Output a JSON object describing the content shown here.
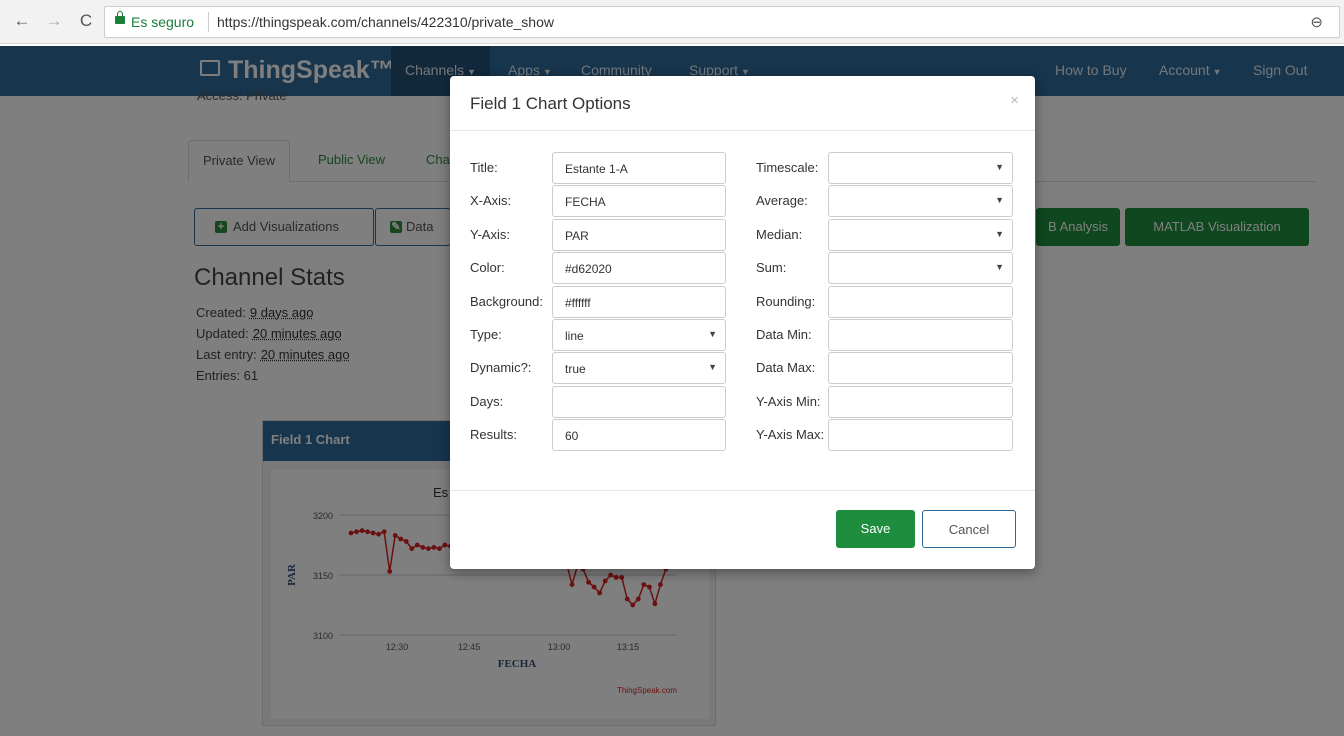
{
  "browser": {
    "secure_label": "Es seguro",
    "url": "https://thingspeak.com/channels/422310/private_show",
    "back_icon": "←",
    "forward_icon": "→",
    "reload_icon": "C",
    "zoom_icon": "⊖"
  },
  "nav": {
    "logo": "ThingSpeak™",
    "items": [
      "Channels",
      "Apps",
      "Community",
      "Support"
    ],
    "right_items": [
      "How to Buy",
      "Account",
      "Sign Out"
    ]
  },
  "page": {
    "access": "Access: Private",
    "tabs": [
      "Private View",
      "Public View",
      "Cha"
    ],
    "add_vis_label": "Add Visualizations",
    "data_label": "Data",
    "analysis_label": "B Analysis",
    "matlab_vis_label": "MATLAB Visualization",
    "stats_title": "Channel Stats",
    "stats": {
      "created_label": "Created:",
      "created_value": "9 days ago",
      "updated_label": "Updated:",
      "updated_value": "20 minutes ago",
      "last_entry_label": "Last entry:",
      "last_entry_value": "20 minutes ago",
      "entries": "Entries: 61"
    }
  },
  "chart_widget": {
    "header": "Field 1 Chart",
    "title_fragment": "Es",
    "credit": "ThingSpeak.com"
  },
  "chart_data": {
    "type": "line",
    "xlabel": "FECHA",
    "ylabel": "PAR",
    "yticks": [
      "3200",
      "3150",
      "3100"
    ],
    "xticks": [
      "12:30",
      "12:45",
      "13:00",
      "13:15"
    ],
    "ylim": [
      3100,
      3200
    ],
    "color": "#d62020",
    "grid": true,
    "segments": [
      {
        "x": [
          0,
          1,
          2,
          3,
          4,
          5,
          6,
          7,
          8,
          9,
          10,
          11,
          12,
          13,
          14,
          15,
          16,
          17,
          18,
          19
        ],
        "y": [
          3185,
          3186,
          3187,
          3186,
          3185,
          3184,
          3186,
          3153,
          3183,
          3180,
          3178,
          3172,
          3175,
          3173,
          3172,
          3173,
          3172,
          3175,
          3174,
          3173
        ]
      },
      {
        "x": [
          39,
          40,
          41,
          42,
          43,
          44,
          45,
          46,
          47,
          48,
          49,
          50,
          51,
          52,
          53,
          54,
          55,
          56,
          57
        ],
        "y": [
          3160,
          3142,
          3158,
          3155,
          3144,
          3140,
          3135,
          3145,
          3150,
          3148,
          3148,
          3130,
          3125,
          3130,
          3142,
          3140,
          3126,
          3142,
          3155
        ]
      }
    ]
  },
  "modal": {
    "title": "Field 1 Chart Options",
    "close": "×",
    "left": [
      {
        "label": "Title:",
        "value": "Estante 1-A",
        "select": false
      },
      {
        "label": "X-Axis:",
        "value": "FECHA",
        "select": false
      },
      {
        "label": "Y-Axis:",
        "value": "PAR",
        "select": false
      },
      {
        "label": "Color:",
        "value": "#d62020",
        "select": false
      },
      {
        "label": "Background:",
        "value": "#ffffff",
        "select": false
      },
      {
        "label": "Type:",
        "value": "line",
        "select": true
      },
      {
        "label": "Dynamic?:",
        "value": "true",
        "select": true
      },
      {
        "label": "Days:",
        "value": "",
        "select": false
      },
      {
        "label": "Results:",
        "value": "60",
        "select": false
      }
    ],
    "right": [
      {
        "label": "Timescale:",
        "value": "",
        "select": true
      },
      {
        "label": "Average:",
        "value": "",
        "select": true
      },
      {
        "label": "Median:",
        "value": "",
        "select": true
      },
      {
        "label": "Sum:",
        "value": "",
        "select": true
      },
      {
        "label": "Rounding:",
        "value": "",
        "select": false
      },
      {
        "label": "Data Min:",
        "value": "",
        "select": false
      },
      {
        "label": "Data Max:",
        "value": "",
        "select": false
      },
      {
        "label": "Y-Axis Min:",
        "value": "",
        "select": false
      },
      {
        "label": "Y-Axis Max:",
        "value": "",
        "select": false
      }
    ],
    "save_label": "Save",
    "cancel_label": "Cancel"
  }
}
